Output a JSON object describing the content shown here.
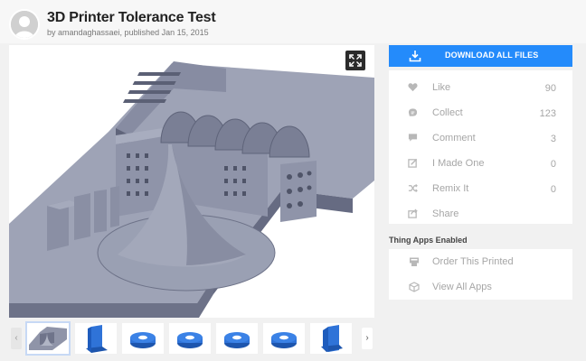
{
  "thing": {
    "title": "3D Printer Tolerance Test",
    "byline": "by amandaghassaei, published Jan 15, 2015"
  },
  "viewer": {
    "expand_icon": "expand-icon"
  },
  "thumbnails": {
    "prev_icon": "chevron-left-icon",
    "next_icon": "chevron-right-icon",
    "items": [
      "model-render",
      "blue-part-upright",
      "blue-ring",
      "blue-ring",
      "blue-ring",
      "blue-ring",
      "blue-part-upright"
    ]
  },
  "sidebar": {
    "download_label": "DOWNLOAD ALL FILES",
    "actions": [
      {
        "label": "Like",
        "count": "90",
        "icon": "heart-icon"
      },
      {
        "label": "Collect",
        "count": "123",
        "icon": "collect-icon"
      },
      {
        "label": "Comment",
        "count": "3",
        "icon": "comment-icon"
      },
      {
        "label": "I Made One",
        "count": "0",
        "icon": "made-one-icon"
      },
      {
        "label": "Remix It",
        "count": "0",
        "icon": "remix-icon"
      },
      {
        "label": "Share",
        "icon": "share-icon"
      }
    ],
    "apps_title": "Thing Apps Enabled",
    "apps": [
      {
        "label": "Order This Printed",
        "icon": "printer-icon"
      },
      {
        "label": "View All Apps",
        "icon": "cube-icon"
      }
    ]
  },
  "colors": {
    "accent": "#248bfb",
    "muted_text": "#a6a6a6",
    "model_gray": "#8a8fa3",
    "part_blue": "#2f73d8"
  }
}
